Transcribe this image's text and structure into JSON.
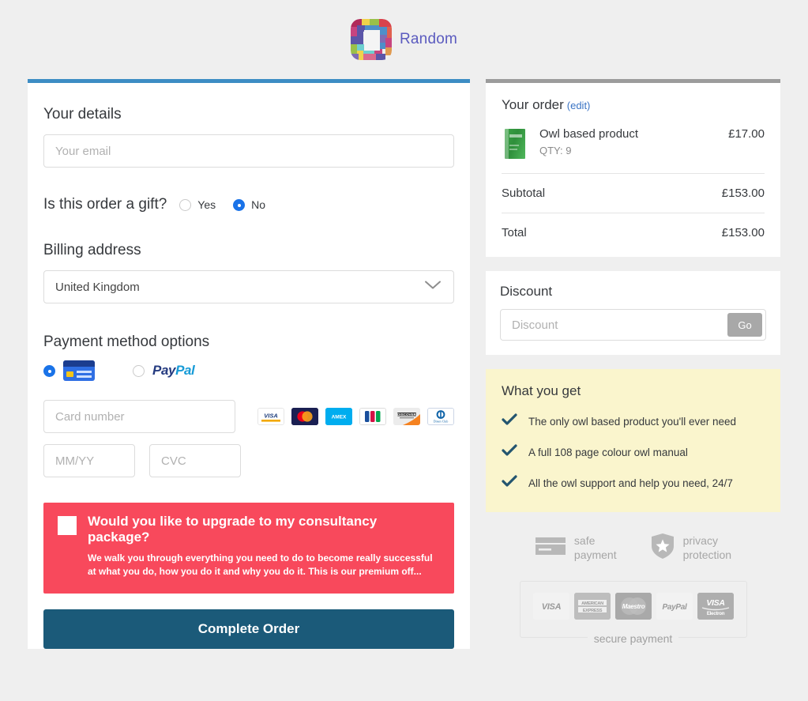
{
  "header": {
    "brand_name": "Random",
    "logo_icon": "pixel-square-logo"
  },
  "form": {
    "details_title": "Your details",
    "email_placeholder": "Your email",
    "email_value": "",
    "gift_question": "Is this order a gift?",
    "gift_options": [
      {
        "label": "Yes",
        "selected": false
      },
      {
        "label": "No",
        "selected": true
      }
    ],
    "billing_title": "Billing address",
    "country_value": "United Kingdom",
    "country_chevron_icon": "chevron-down-icon",
    "payment_title": "Payment method options",
    "payment_methods": [
      {
        "label": "Credit card",
        "icon": "credit-card-icon",
        "selected": true
      },
      {
        "label": "PayPal",
        "icon": "paypal-logo",
        "selected": false
      }
    ],
    "paypal_part1": "Pay",
    "paypal_part2": "Pal",
    "card_number_placeholder": "Card number",
    "card_number_value": "",
    "expiry_placeholder": "MM/YY",
    "expiry_value": "",
    "cvc_placeholder": "CVC",
    "cvc_value": "",
    "accepted_cards": [
      {
        "name": "visa-icon",
        "label": "VISA"
      },
      {
        "name": "mastercard-icon",
        "label": ""
      },
      {
        "name": "amex-icon",
        "label": "AMEX"
      },
      {
        "name": "jcb-icon",
        "label": ""
      },
      {
        "name": "discover-icon",
        "label": "DISCOVER"
      },
      {
        "name": "diners-club-icon",
        "label": "Diners Club"
      }
    ],
    "upsell": {
      "checked": false,
      "heading": "Would you like to upgrade to my consultancy package?",
      "body": "We walk you through everything you need to do to become really successful at what you do, how you do it and why you do it. This is our premium off..."
    },
    "submit_label": "Complete Order"
  },
  "order": {
    "title": "Your order",
    "edit_label": "(edit)",
    "items": [
      {
        "name": "Owl based product",
        "qty_label": "QTY: 9",
        "price": "£17.00",
        "thumb_icon": "green-product-box"
      }
    ],
    "subtotal_label": "Subtotal",
    "subtotal_value": "£153.00",
    "total_label": "Total",
    "total_value": "£153.00"
  },
  "discount": {
    "title": "Discount",
    "placeholder": "Discount",
    "value": "",
    "button_label": "Go"
  },
  "benefits": {
    "title": "What you get",
    "check_icon": "check-icon",
    "items": [
      "The only owl based product you'll ever need",
      "A full 108 page colour owl manual",
      "All the owl support and help you need, 24/7"
    ]
  },
  "trust": [
    {
      "icon": "credit-card-icon",
      "line1": "safe",
      "line2": "payment"
    },
    {
      "icon": "shield-star-icon",
      "line1": "privacy",
      "line2": "protection"
    }
  ],
  "secure": {
    "caption": "secure payment",
    "logos": [
      {
        "name": "visa-logo",
        "line1": "VISA",
        "line2": ""
      },
      {
        "name": "american-express-logo",
        "line1": "AMERICAN",
        "line2": "EXPRESS"
      },
      {
        "name": "maestro-logo",
        "line1": "Maestro",
        "line2": ""
      },
      {
        "name": "paypal-logo",
        "line1": "PayPal",
        "line2": ""
      },
      {
        "name": "visa-electron-logo",
        "line1": "VISA",
        "line2": "Electron"
      }
    ]
  },
  "colors": {
    "accent_blue": "#3d8dc4",
    "submit_blue": "#1b5a79",
    "upsell_red": "#f8495c",
    "benefits_yellow": "#faf5cd",
    "radio_blue": "#1a73e8",
    "link_blue": "#3973c4",
    "page_bg": "#efefef"
  }
}
